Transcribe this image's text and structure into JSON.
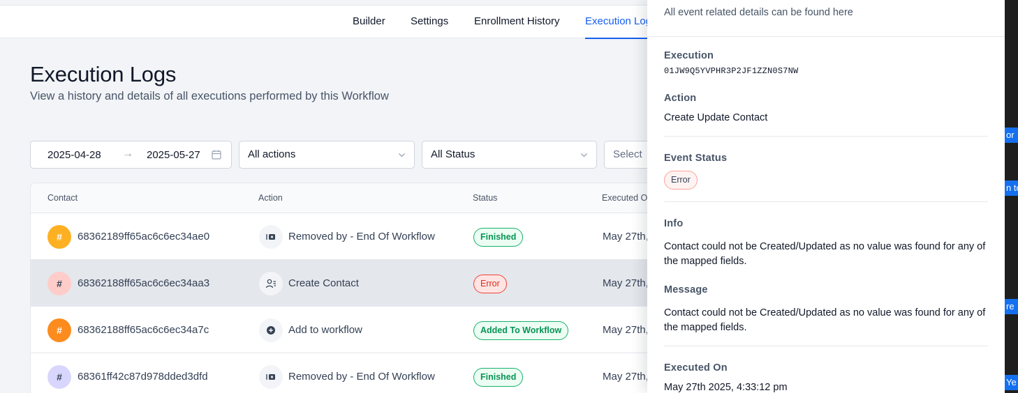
{
  "tabs": [
    {
      "label": "Builder",
      "active": false
    },
    {
      "label": "Settings",
      "active": false
    },
    {
      "label": "Enrollment History",
      "active": false
    },
    {
      "label": "Execution Logs",
      "active": true
    }
  ],
  "page": {
    "title": "Execution Logs",
    "subtitle": "View a history and details of all executions performed by this Workflow"
  },
  "filters": {
    "date_start": "2025-04-28",
    "date_arrow": "→",
    "date_end": "2025-05-27",
    "actions_value": "All actions",
    "status_value": "All Status",
    "select_placeholder": "Select"
  },
  "table": {
    "headers": {
      "contact": "Contact",
      "action": "Action",
      "status": "Status",
      "executed_on": "Executed O"
    },
    "rows": [
      {
        "avatar": "#",
        "contact_id": "68362189ff65ac6c6ec34ae0",
        "action": "Removed by - End Of Workflow",
        "action_icon": "remove-icon",
        "status": "Finished",
        "executed": "May 27th,"
      },
      {
        "avatar": "#",
        "contact_id": "68362188ff65ac6c6ec34aa3",
        "action": "Create Contact",
        "action_icon": "user-list-icon",
        "status": "Error",
        "executed": "May 27th,"
      },
      {
        "avatar": "#",
        "contact_id": "68362188ff65ac6c6ec34a7c",
        "action": "Add to workflow",
        "action_icon": "plus-circle-icon",
        "status": "Added To Workflow",
        "executed": "May 27th,"
      },
      {
        "avatar": "#",
        "contact_id": "68361ff42c87d978dded3dfd",
        "action": "Removed by - End Of Workflow",
        "action_icon": "remove-icon",
        "status": "Finished",
        "executed": "May 27th,"
      }
    ]
  },
  "drawer": {
    "subtitle": "All event related details can be found here",
    "execution_label": "Execution",
    "execution_id": "01JW9Q5YVPHR3P2JF1ZZN0S7NW",
    "action_label": "Action",
    "action_value": "Create Update Contact",
    "event_status_label": "Event Status",
    "event_status_value": "Error",
    "info_label": "Info",
    "info_value": "Contact could not be Created/Updated as no value was found for any of the mapped fields.",
    "message_label": "Message",
    "message_value": "Contact could not be Created/Updated as no value was found for any of the mapped fields.",
    "executed_on_label": "Executed On",
    "executed_on_value": "May 27th 2025, 4:33:12 pm"
  },
  "right_strip": {
    "chips": [
      "or",
      "n to",
      "re",
      "Ye"
    ]
  },
  "colors": {
    "accent": "#155eef",
    "avatar_colors": [
      "#fdb022",
      "#fecdca",
      "#fb8c1d",
      "#d9d6fe"
    ],
    "avatar_text": [
      "#ffffff",
      "#344054",
      "#ffffff",
      "#344054"
    ]
  }
}
